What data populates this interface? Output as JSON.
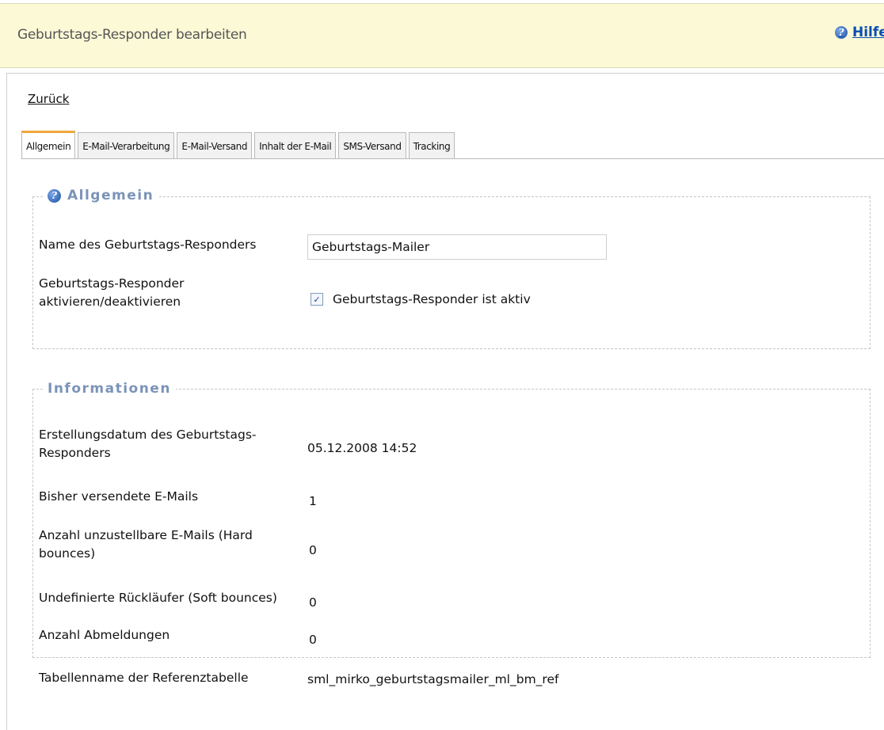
{
  "header": {
    "title": "Geburtstags-Responder bearbeiten",
    "help_label": "Hilfe",
    "help_icon": "help-question-icon"
  },
  "nav": {
    "back_label": "Zurück"
  },
  "tabs": [
    {
      "label": "Allgemein",
      "active": true
    },
    {
      "label": "E-Mail-Verarbeitung",
      "active": false
    },
    {
      "label": "E-Mail-Versand",
      "active": false
    },
    {
      "label": "Inhalt der E-Mail",
      "active": false
    },
    {
      "label": "SMS-Versand",
      "active": false
    },
    {
      "label": "Tracking",
      "active": false
    }
  ],
  "general": {
    "legend": "Allgemein",
    "name_label": "Name des Geburtstags-Responders",
    "name_value": "Geburtstags-Mailer",
    "activate_label": "Geburtstags-Responder aktivieren/deaktivieren",
    "activate_checked": true,
    "activate_option": "Geburtstags-Responder ist aktiv"
  },
  "info": {
    "legend": "Informationen",
    "rows": [
      {
        "label": "Erstellungsdatum des Geburtstags-Responders",
        "value": "05.12.2008 14:52"
      },
      {
        "label": "Bisher versendete E-Mails",
        "value": "1"
      },
      {
        "label": "Anzahl unzustellbare E-Mails (Hard bounces)",
        "value": "0"
      },
      {
        "label": "Undefinierte Rückläufer (Soft bounces)",
        "value": "0"
      },
      {
        "label": "Anzahl Abmeldungen",
        "value": "0"
      },
      {
        "label": "Tabellenname der Referenztabelle",
        "value": "sml_mirko_geburtstagsmailer_ml_bm_ref"
      }
    ]
  },
  "colors": {
    "header_bg": "#fcf9d6",
    "accent_tab": "#f0a73a",
    "legend_text": "#7b93b8",
    "link_blue": "#0a4fb5"
  }
}
